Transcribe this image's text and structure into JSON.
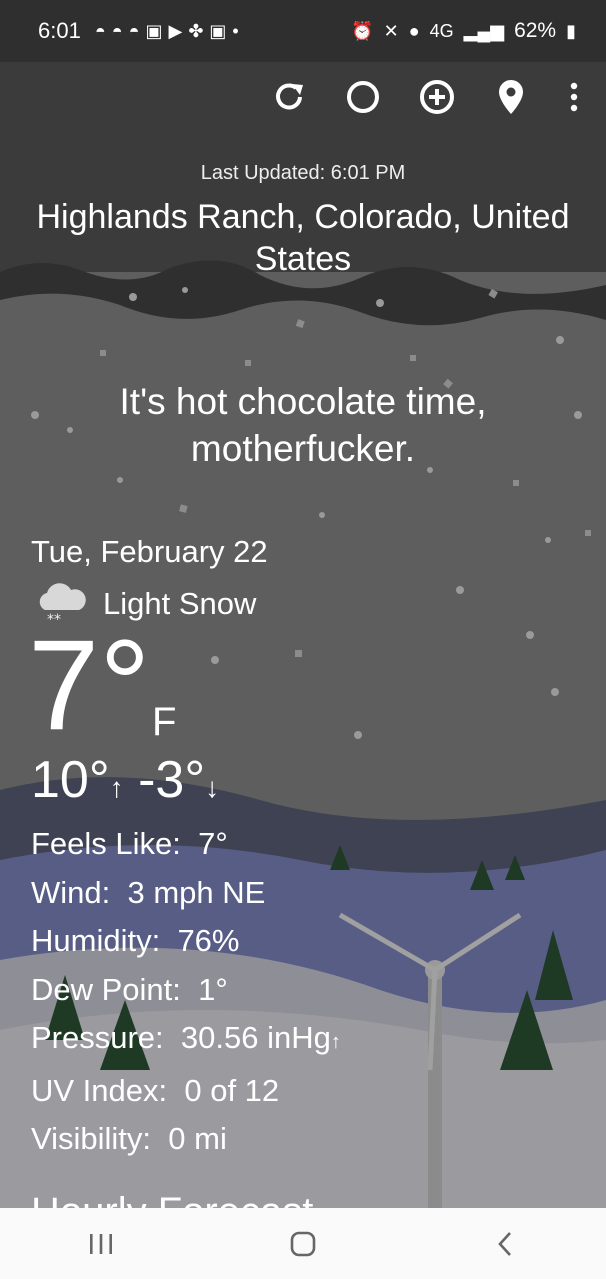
{
  "status_bar": {
    "time": "6:01",
    "network": "4G",
    "battery": "62%"
  },
  "toolbar": {
    "refresh_icon": "refresh-icon",
    "theme_icon": "moon-icon",
    "add_icon": "add-circle-icon",
    "location_icon": "location-pin-icon",
    "more_icon": "more-vert-icon"
  },
  "weather": {
    "last_updated": "Last Updated: 6:01 PM",
    "location": "Highlands Ranch, Colorado, United States",
    "quip": "It's hot chocolate time, motherfucker.",
    "date": "Tue, February 22",
    "condition": "Light Snow",
    "temperature": "7°",
    "unit": "F",
    "high": "10°",
    "low": "-3°",
    "details": [
      {
        "label": "Feels Like:",
        "value": "7°"
      },
      {
        "label": "Wind:",
        "value": "3 mph NE"
      },
      {
        "label": "Humidity:",
        "value": "76%"
      },
      {
        "label": "Dew Point:",
        "value": "1°"
      },
      {
        "label": "Pressure:",
        "value": "30.56 inHg"
      },
      {
        "label": "UV Index:",
        "value": "0 of 12"
      },
      {
        "label": "Visibility:",
        "value": "0 mi"
      }
    ],
    "hourly_heading": "Hourly Forecast"
  },
  "nav_bar": {
    "recents_icon": "recents-icon",
    "home_icon": "home-icon",
    "back_icon": "back-icon"
  },
  "colors": {
    "status_bar_bg": "#2f2f2f",
    "sky": "#5d5d5d",
    "hills": "#424556",
    "snow_ground": "#8d8d96",
    "tree": "#1f3322",
    "nav_bar_bg": "#fafafa"
  }
}
